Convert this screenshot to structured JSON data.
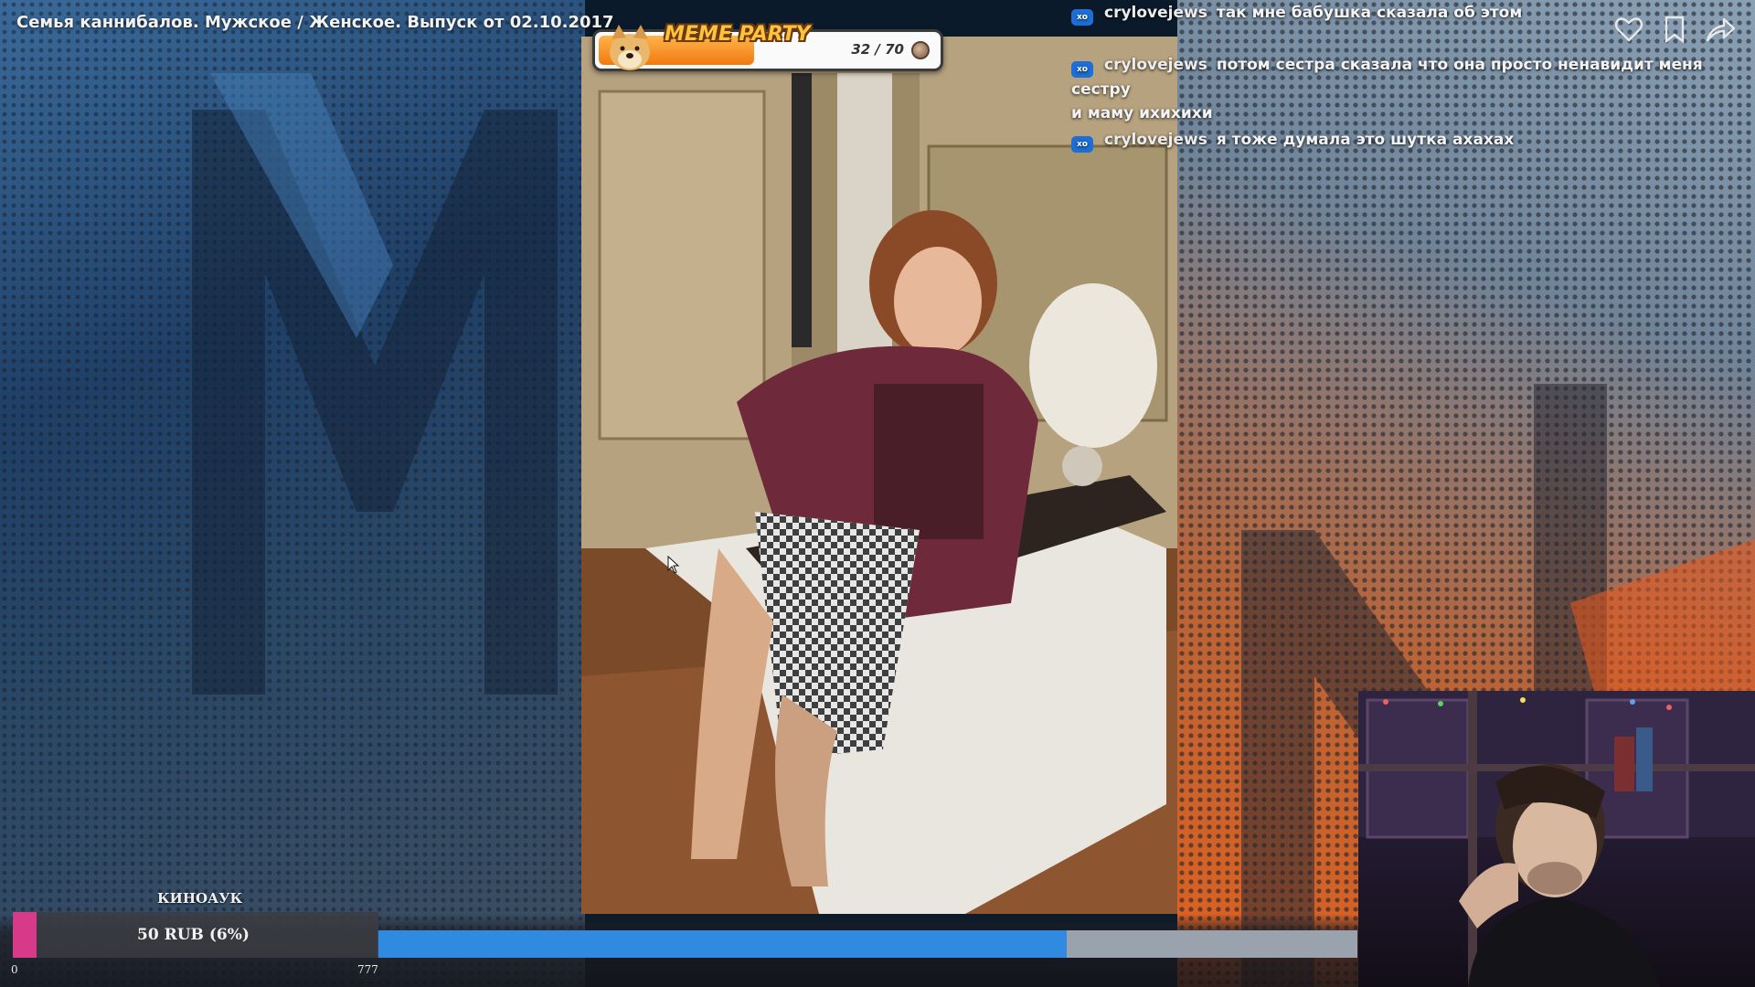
{
  "video": {
    "title": "Семья каннибалов. Мужское / Женское. Выпуск от 02.10.2017"
  },
  "meme_party": {
    "title": "MEME PARTY",
    "count_text": "32 / 70",
    "progress": 0.457
  },
  "chat": {
    "messages": [
      {
        "badge": "xo",
        "user": "crylovejews",
        "text": "так мне бабушка сказала об этом"
      },
      {
        "badge": "xo",
        "user": "crylovejews",
        "text": "потом сестра сказала что она просто ненавидит меня сестру",
        "text2": "и маму ихихихи"
      },
      {
        "badge": "xo",
        "user": "crylovejews",
        "text": "я тоже думала это шутка ахахах"
      }
    ]
  },
  "icons": {
    "like": "heart-icon",
    "bookmark": "bookmark-icon",
    "share": "share-icon",
    "cursor": "mouse-cursor-icon"
  },
  "donation": {
    "label": "КИНОАУК",
    "amount_text": "50 RUB (6%)",
    "fraction": 0.064,
    "scale_min": "0",
    "scale_max": "777",
    "accent_color": "#d83a8a"
  },
  "video_progress": {
    "fraction": 0.703,
    "color": "#2f8ae0"
  }
}
